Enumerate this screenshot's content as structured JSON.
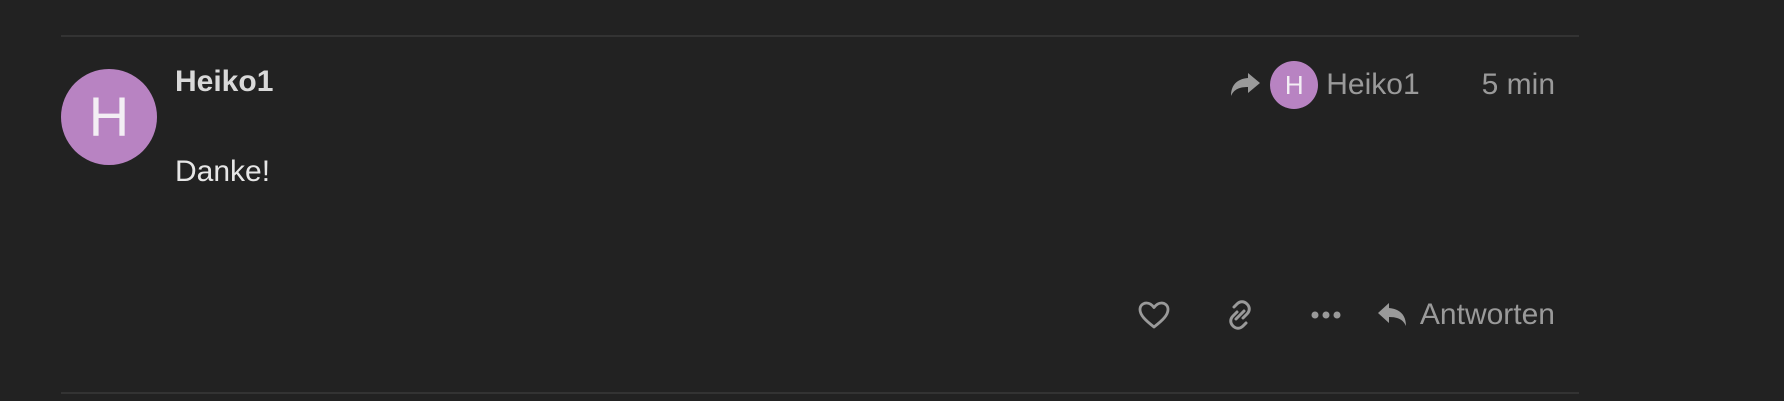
{
  "post": {
    "avatar_letter": "H",
    "avatar_color": "#b883c2",
    "username": "Heiko1",
    "body": "Danke!",
    "reply_to": {
      "icon": "share-forward-icon",
      "avatar_letter": "H",
      "username": "Heiko1"
    },
    "time": "5 min"
  },
  "actions": {
    "like_icon": "heart-icon",
    "link_icon": "link-icon",
    "more_icon": "ellipsis-icon",
    "reply_icon": "reply-icon",
    "reply_label": "Antworten"
  }
}
